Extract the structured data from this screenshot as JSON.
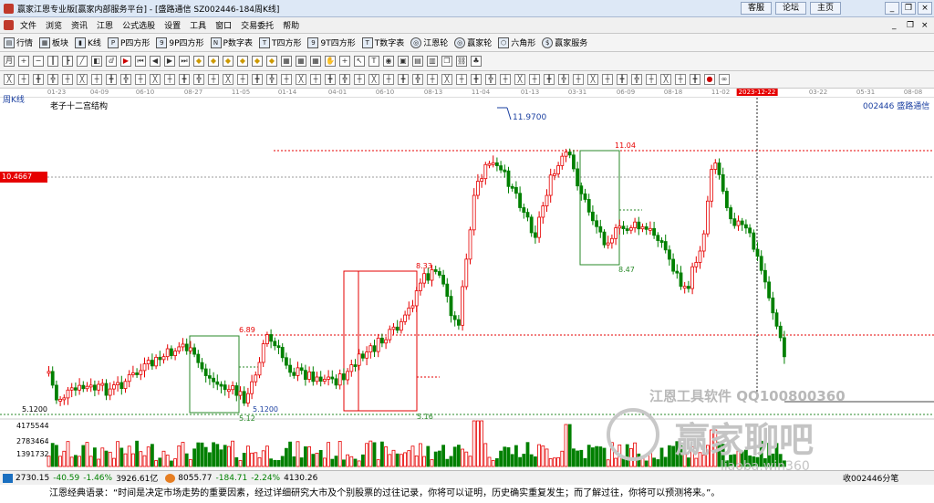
{
  "titlebar": {
    "title": "赢家江恩专业版[赢家内部服务平台] - [盛路通信 SZ002446-184周K线]",
    "buttons": [
      "客服",
      "论坛",
      "主页"
    ]
  },
  "menu": [
    "文件",
    "浏览",
    "资讯",
    "江恩",
    "公式选股",
    "设置",
    "工具",
    "窗口",
    "交易委托",
    "帮助"
  ],
  "toolbar": [
    "行情",
    "板块",
    "K线",
    "P四方形",
    "9P四方形",
    "P数字表",
    "T四方形",
    "9T四方形",
    "T数字表",
    "江恩轮",
    "赢家轮",
    "六角形",
    "赢家服务"
  ],
  "date_axis": [
    "01-23",
    "04-09",
    "06-10",
    "08-27",
    "11-05",
    "01-14",
    "04-01",
    "06-10",
    "08-13",
    "11-04",
    "01-13",
    "03-31",
    "06-09",
    "08-18",
    "11-02",
    "2023-12-22",
    "03-22",
    "05-31",
    "08-08"
  ],
  "chart": {
    "period_label": "周K线",
    "structure_label": "老子十二宫结构",
    "stock_label": "002446 盛路通信",
    "crosshair_price": "10.4667",
    "price_labels": [
      "11.9700",
      "11.04",
      "8.33",
      "8.47",
      "6.89",
      "5.12",
      "5.1200",
      "5.16"
    ],
    "left_axis": [
      "5.1200",
      "4175544",
      "2783464",
      "1391732"
    ],
    "up_color": "#e60000",
    "down_color": "#008000"
  },
  "watermark": {
    "tool": "江恩工具软件 QQ100800360",
    "brand": "赢家聊吧",
    "sub": "liaoba.win360"
  },
  "statusbar": {
    "sh_index": "2730.15",
    "sh_change": "-40.59",
    "sh_pct": "-1.46%",
    "sh_volume": "3926.61亿",
    "sz_index": "8055.77",
    "sz_change": "-184.71",
    "sz_pct": "-2.24%",
    "sz_volume": "4130.26",
    "tail": "收002446分笔"
  },
  "quote": "江恩经典语录：“时间是决定市场走势的重要因素，经过详细研究大市及个别股票的过往记录，你将可以证明，历史确实重复发生；而了解过往，你将可以预测将来。”。"
}
